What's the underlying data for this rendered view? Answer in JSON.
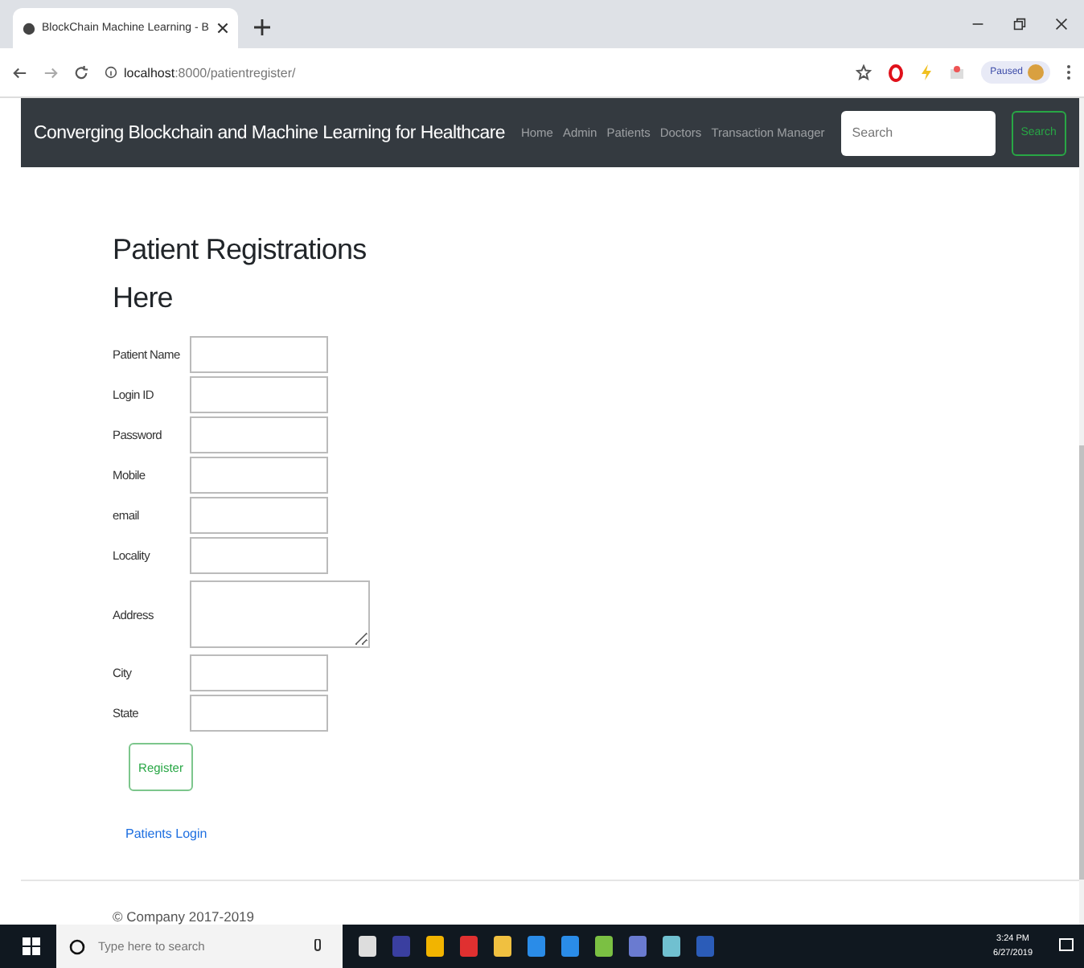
{
  "browser": {
    "tab_title": "BlockChain Machine Learning - B",
    "url_host": "localhost",
    "url_rest": ":8000/patientregister/",
    "profile_label": "Paused"
  },
  "navbar": {
    "brand": "Converging Blockchain and Machine Learning for Healthcare",
    "links": [
      "Home",
      "Admin",
      "Patients",
      "Doctors",
      "Transaction Manager"
    ],
    "search": {
      "placeholder": "Search"
    },
    "search_button": "Search"
  },
  "form": {
    "heading": "Patient Registrations Here",
    "fields": [
      {
        "label": "Patient Name",
        "kind": "input"
      },
      {
        "label": "Login ID",
        "kind": "input"
      },
      {
        "label": "Password",
        "kind": "input"
      },
      {
        "label": "Mobile",
        "kind": "input"
      },
      {
        "label": "email",
        "kind": "input"
      },
      {
        "label": "Locality",
        "kind": "input"
      },
      {
        "label": "Address",
        "kind": "textarea"
      },
      {
        "label": "City",
        "kind": "input"
      },
      {
        "label": "State",
        "kind": "input"
      }
    ],
    "submit": "Register",
    "link": "Patients Login"
  },
  "footer": "© Company 2017-2019",
  "taskbar": {
    "search": {
      "placeholder": "Type here to search"
    },
    "time": "3:24 PM",
    "date": "6/27/2019"
  }
}
